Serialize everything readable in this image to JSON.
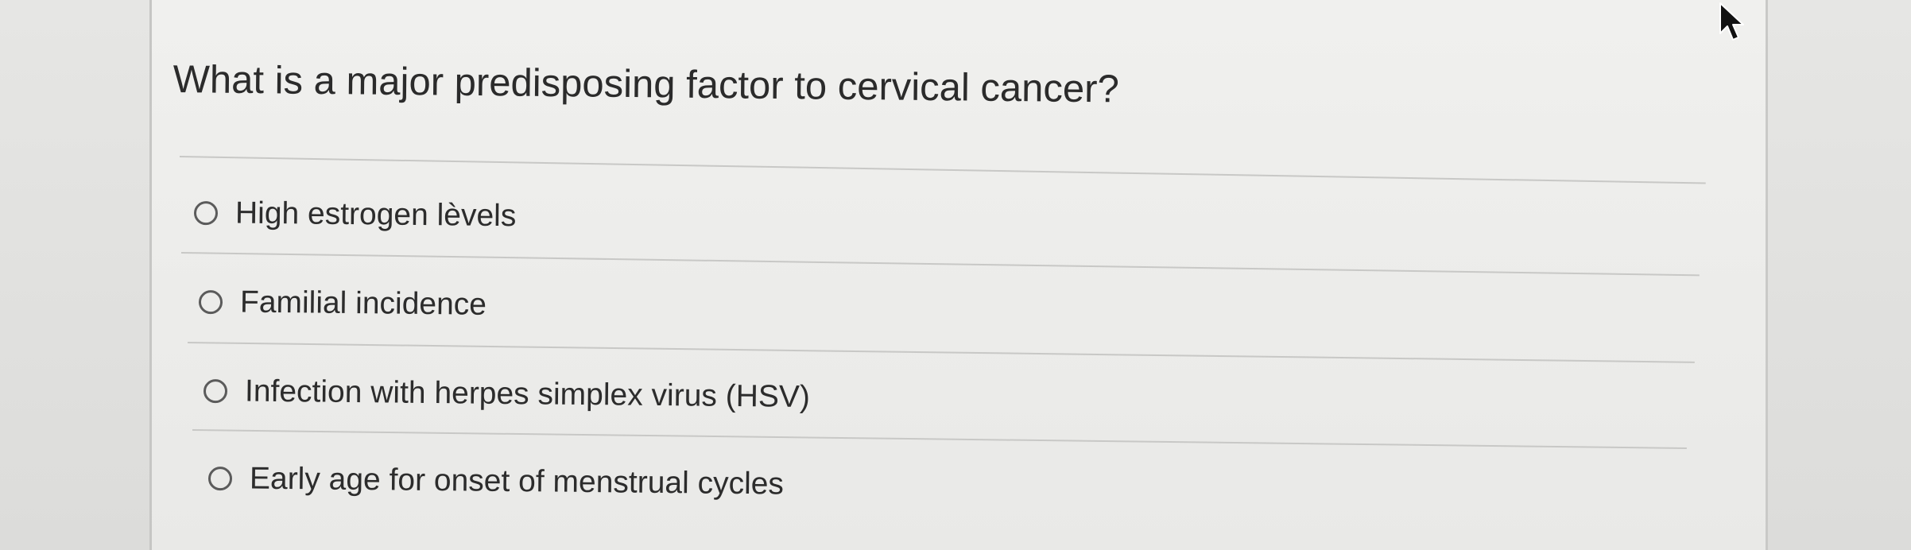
{
  "quiz": {
    "question": "What is a major predisposing factor to cervical cancer?",
    "options": [
      {
        "label": "High estrogen lèvels",
        "selected": false
      },
      {
        "label": "Familial incidence",
        "selected": false
      },
      {
        "label": "Infection with herpes simplex virus (HSV)",
        "selected": false
      },
      {
        "label": "Early age for onset of menstrual cycles",
        "selected": false
      }
    ]
  },
  "icons": {
    "cursor": "mouse-pointer-icon",
    "radio": "radio-button-unchecked"
  }
}
